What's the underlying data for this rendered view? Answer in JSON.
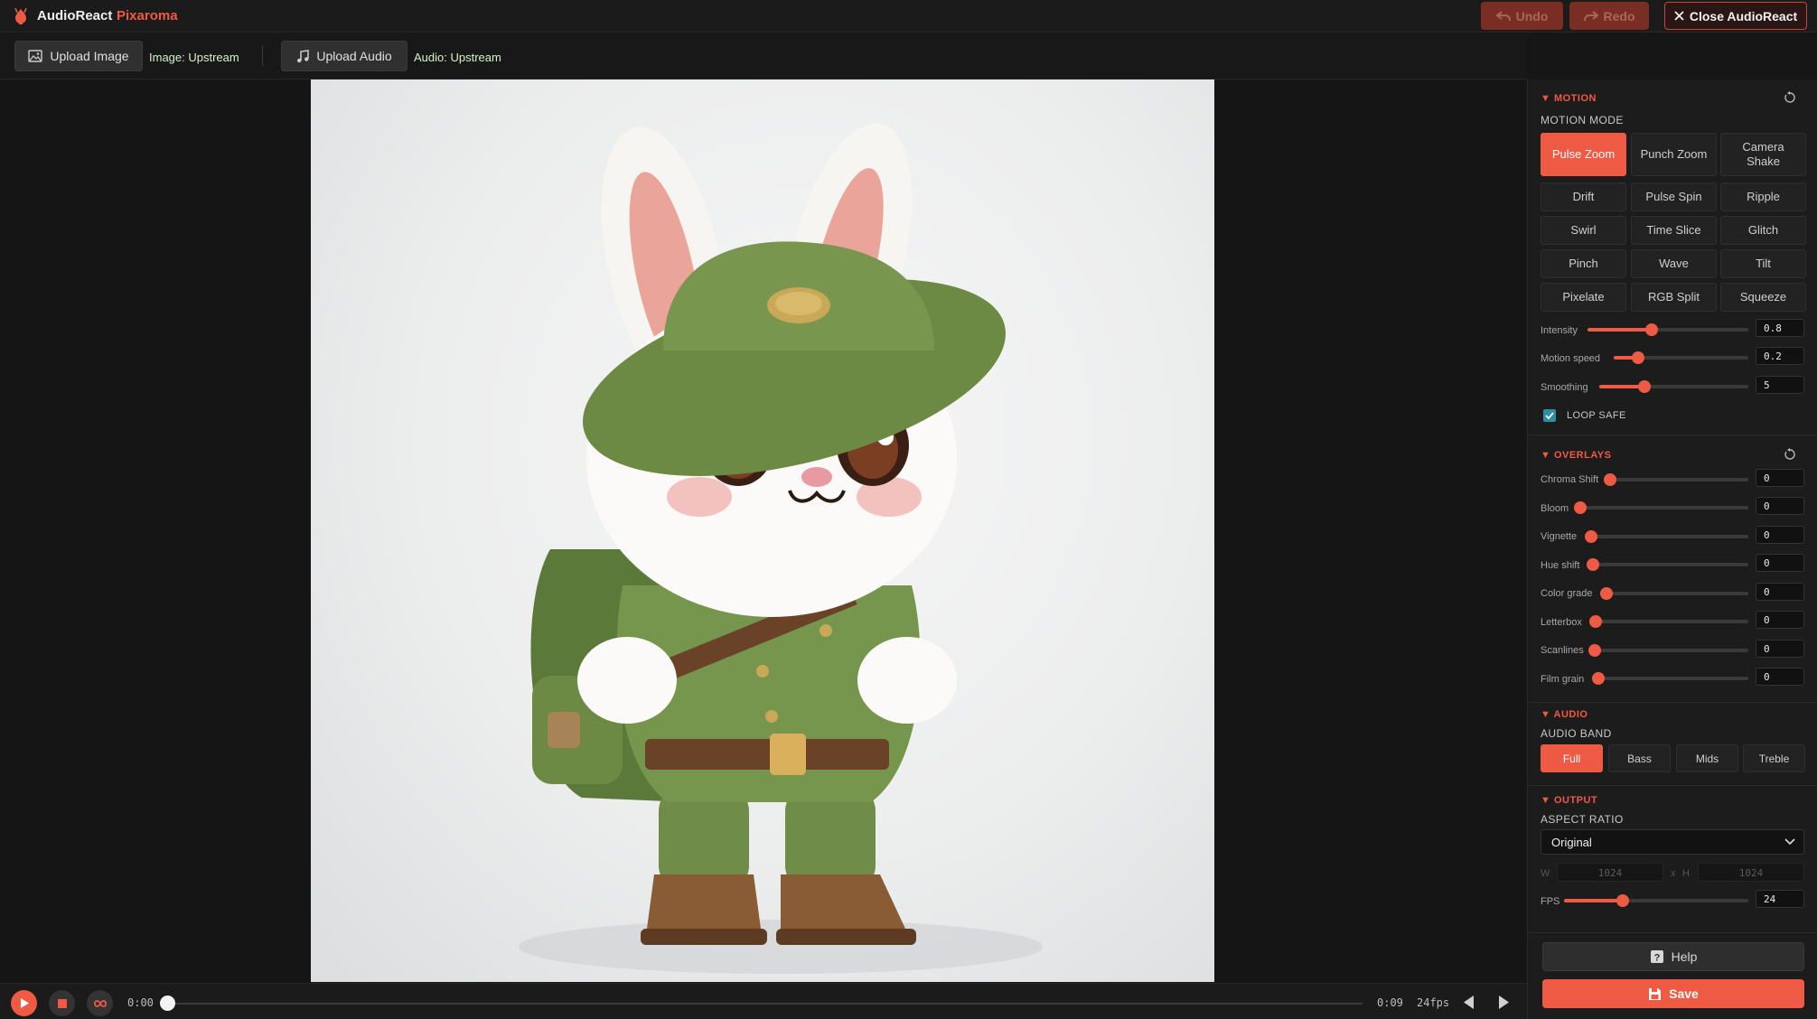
{
  "app": {
    "title": "AudioReact",
    "brand": "Pixaroma"
  },
  "toolbar": {
    "undo_label": "Undo",
    "redo_label": "Redo",
    "close_label": "Close AudioReact"
  },
  "uploads": {
    "image_button": "Upload Image",
    "image_status": "Image: Upstream",
    "audio_button": "Upload Audio",
    "audio_status": "Audio: Upstream"
  },
  "transport": {
    "current_time": "0:00",
    "total_time": "0:09",
    "fps_label": "24fps",
    "progress": 0.0
  },
  "motion": {
    "title": "MOTION",
    "mode_label": "MOTION MODE",
    "modes": [
      "Pulse Zoom",
      "Punch Zoom",
      "Camera Shake",
      "Drift",
      "Pulse Spin",
      "Ripple",
      "Swirl",
      "Time Slice",
      "Glitch",
      "Pinch",
      "Wave",
      "Tilt",
      "Pixelate",
      "RGB Split",
      "Squeeze"
    ],
    "active_mode": "Pulse Zoom",
    "sliders": [
      {
        "label": "Intensity",
        "value": "0.8",
        "fraction": 0.4
      },
      {
        "label": "Motion speed",
        "value": "0.2",
        "fraction": 0.18
      },
      {
        "label": "Smoothing",
        "value": "5",
        "fraction": 0.3
      }
    ],
    "loop_safe_label": "LOOP SAFE",
    "loop_safe_checked": true
  },
  "overlays": {
    "title": "OVERLAYS",
    "sliders": [
      {
        "label": "Chroma Shift",
        "value": "0",
        "fraction": 0
      },
      {
        "label": "Bloom",
        "value": "0",
        "fraction": 0
      },
      {
        "label": "Vignette",
        "value": "0",
        "fraction": 0
      },
      {
        "label": "Hue shift",
        "value": "0",
        "fraction": 0
      },
      {
        "label": "Color grade",
        "value": "0",
        "fraction": 0
      },
      {
        "label": "Letterbox",
        "value": "0",
        "fraction": 0
      },
      {
        "label": "Scanlines",
        "value": "0",
        "fraction": 0
      },
      {
        "label": "Film grain",
        "value": "0",
        "fraction": 0
      }
    ]
  },
  "audio": {
    "title": "AUDIO",
    "band_label": "AUDIO BAND",
    "bands": [
      "Full",
      "Bass",
      "Mids",
      "Treble"
    ],
    "active_band": "Full"
  },
  "output": {
    "title": "OUTPUT",
    "aspect_label": "ASPECT RATIO",
    "aspect_value": "Original",
    "width_label": "W",
    "width_value": "1024",
    "times_label": "x",
    "height_label": "H",
    "height_value": "1024",
    "fps_label": "FPS",
    "fps_value": "24",
    "fps_fraction": 0.32
  },
  "footer": {
    "help_label": "Help",
    "save_label": "Save"
  },
  "colors": {
    "accent": "#ef5a44",
    "panel_bg": "#1c1c1c",
    "app_bg": "#161616",
    "checkbox": "#2c8fa3"
  }
}
